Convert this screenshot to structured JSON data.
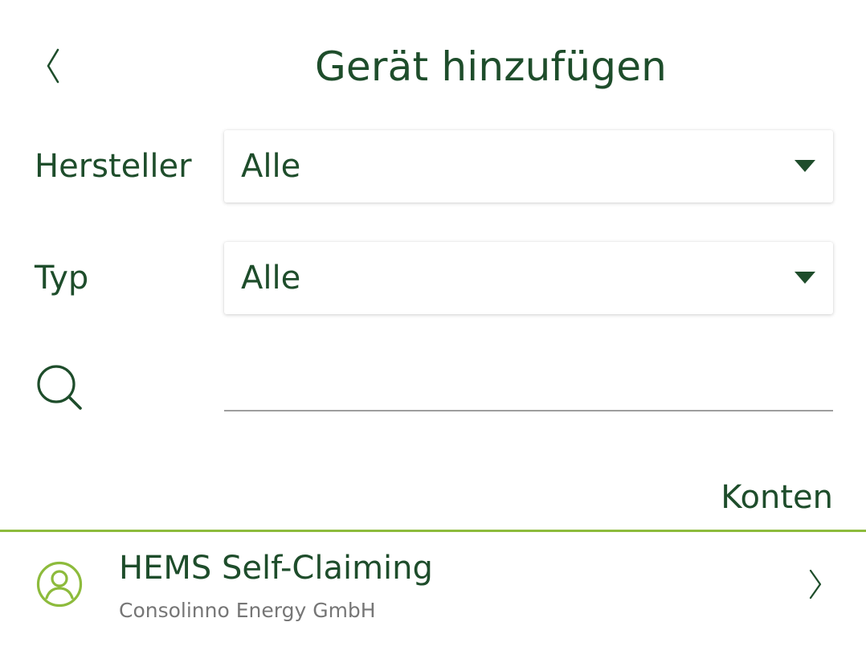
{
  "header": {
    "title": "Gerät hinzufügen",
    "back_icon": "chevron-left-icon"
  },
  "filters": {
    "manufacturer": {
      "label": "Hersteller",
      "selected": "Alle"
    },
    "type": {
      "label": "Typ",
      "selected": "Alle"
    }
  },
  "search": {
    "icon": "search-icon",
    "value": "",
    "placeholder": ""
  },
  "section": {
    "title": "Konten",
    "accent_color": "#8dbb3c"
  },
  "items": [
    {
      "title": "HEMS Self-Claiming",
      "subtitle": "Consolinno Energy GmbH",
      "icon": "account-icon",
      "trailing_icon": "chevron-right-icon"
    }
  ],
  "colors": {
    "primary_text": "#1e4d2b",
    "secondary_text": "#767676",
    "accent": "#8dbb3c",
    "input_underline": "#9e9e9e"
  }
}
